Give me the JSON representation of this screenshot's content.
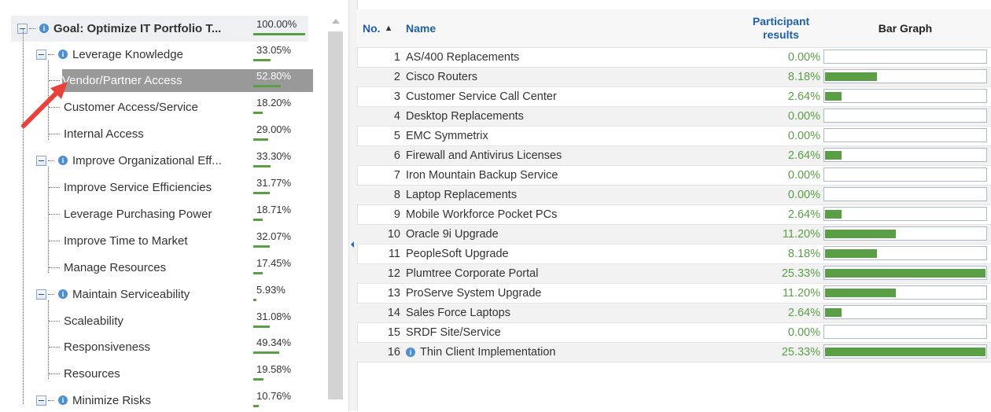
{
  "tree": {
    "goal": {
      "label": "Goal: Optimize IT Portfolio T...",
      "pct": "100.00%",
      "value": 1.0
    },
    "nodes": [
      {
        "label": "Leverage Knowledge",
        "pct": "33.05%",
        "value": 0.3305
      },
      {
        "label": "Vendor/Partner Access",
        "pct": "52.80%",
        "value": 0.528
      },
      {
        "label": "Customer Access/Service",
        "pct": "18.20%",
        "value": 0.182
      },
      {
        "label": "Internal Access",
        "pct": "29.00%",
        "value": 0.29
      },
      {
        "label": "Improve Organizational Eff...",
        "pct": "33.30%",
        "value": 0.333
      },
      {
        "label": "Improve Service Efficiencies",
        "pct": "31.77%",
        "value": 0.3177
      },
      {
        "label": "Leverage Purchasing Power",
        "pct": "18.71%",
        "value": 0.1871
      },
      {
        "label": "Improve Time to Market",
        "pct": "32.07%",
        "value": 0.3207
      },
      {
        "label": "Manage Resources",
        "pct": "17.45%",
        "value": 0.1745
      },
      {
        "label": "Maintain Serviceability",
        "pct": "5.93%",
        "value": 0.0593
      },
      {
        "label": "Scaleability",
        "pct": "31.08%",
        "value": 0.3108
      },
      {
        "label": "Responsiveness",
        "pct": "49.34%",
        "value": 0.4934
      },
      {
        "label": "Resources",
        "pct": "19.58%",
        "value": 0.1958
      },
      {
        "label": "Minimize Risks",
        "pct": "10.76%",
        "value": 0.1076
      }
    ]
  },
  "grid": {
    "headers": {
      "no": "No.",
      "sort_icon": "▲",
      "name": "Name",
      "results_line1": "Participant",
      "results_line2": "results",
      "bar": "Bar Graph"
    },
    "rows": [
      {
        "no": "1",
        "name": "AS/400 Replacements",
        "result": "0.00%",
        "value": 0.0
      },
      {
        "no": "2",
        "name": "Cisco Routers",
        "result": "8.18%",
        "value": 8.18
      },
      {
        "no": "3",
        "name": "Customer Service Call Center",
        "result": "2.64%",
        "value": 2.64
      },
      {
        "no": "4",
        "name": "Desktop Replacements",
        "result": "0.00%",
        "value": 0.0
      },
      {
        "no": "5",
        "name": "EMC Symmetrix",
        "result": "0.00%",
        "value": 0.0
      },
      {
        "no": "6",
        "name": "Firewall and Antivirus Licenses",
        "result": "2.64%",
        "value": 2.64
      },
      {
        "no": "7",
        "name": "Iron Mountain Backup Service",
        "result": "0.00%",
        "value": 0.0
      },
      {
        "no": "8",
        "name": "Laptop Replacements",
        "result": "0.00%",
        "value": 0.0
      },
      {
        "no": "9",
        "name": "Mobile Workforce Pocket PCs",
        "result": "2.64%",
        "value": 2.64
      },
      {
        "no": "10",
        "name": "Oracle 9i Upgrade",
        "result": "11.20%",
        "value": 11.2
      },
      {
        "no": "11",
        "name": "PeopleSoft Upgrade",
        "result": "8.18%",
        "value": 8.18
      },
      {
        "no": "12",
        "name": "Plumtree Corporate Portal",
        "result": "25.33%",
        "value": 25.33
      },
      {
        "no": "13",
        "name": "ProServe System Upgrade",
        "result": "11.20%",
        "value": 11.2
      },
      {
        "no": "14",
        "name": "Sales Force Laptops",
        "result": "2.64%",
        "value": 2.64
      },
      {
        "no": "15",
        "name": "SRDF Site/Service",
        "result": "0.00%",
        "value": 0.0
      },
      {
        "no": "16",
        "name": "Thin Client Implementation",
        "result": "25.33%",
        "value": 25.33,
        "has_info": true
      }
    ],
    "bar_max": 25.33
  },
  "colors": {
    "accent": "#5a9e46",
    "header_text": "#1f5fa8",
    "selected_bg": "#999999",
    "arrow": "#e8423b",
    "info_icon": "#4e8fd0"
  },
  "icons": {
    "expander": "collapse-icon",
    "info": "info-icon",
    "sort": "sort-ascending-icon"
  }
}
